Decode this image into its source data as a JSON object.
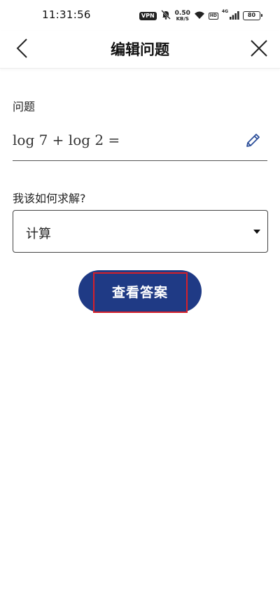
{
  "status_bar": {
    "time": "11:31:56",
    "vpn": "VPN",
    "net_speed_value": "0.50",
    "net_speed_unit": "KB/S",
    "hd": "HD",
    "signal_label": "4G",
    "battery": "80"
  },
  "header": {
    "title": "编辑问题",
    "back_icon": "chevron-left-icon",
    "close_icon": "close-icon"
  },
  "question": {
    "label": "问题",
    "formula": "log 7 + log 2 =",
    "edit_icon": "pencil-icon"
  },
  "method": {
    "label": "我该如何求解?",
    "selected": "计算"
  },
  "action": {
    "button_label": "查看答案"
  },
  "colors": {
    "primary_button": "#1f3a85",
    "highlight": "#d6202a",
    "pencil": "#2d4f9a"
  }
}
